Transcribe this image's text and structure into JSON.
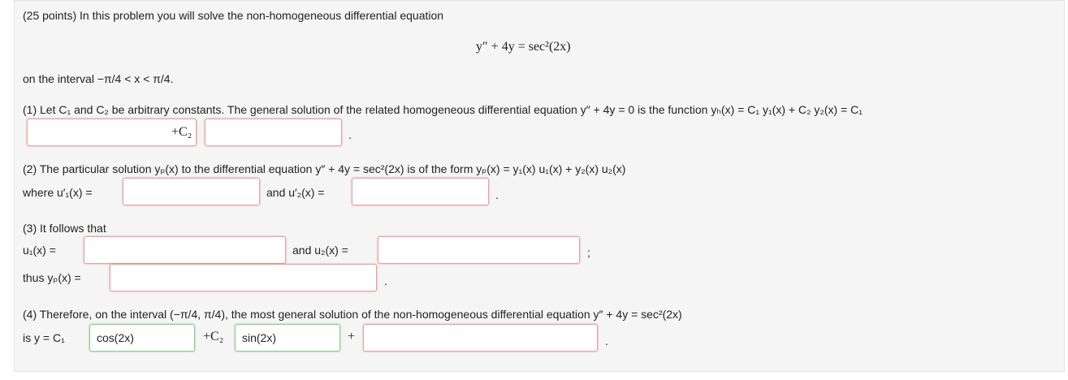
{
  "problem": {
    "header": "(25 points) In this problem you will solve the non-homogeneous differential equation",
    "main_equation": "y″ + 4y = sec²(2x)",
    "interval_text": "on the interval −π/4 < x < π/4."
  },
  "part1": {
    "text": "(1) Let C₁ and C₂ be arbitrary constants. The general solution of the related homogeneous differential equation y″ + 4y = 0 is the function yₕ(x) = C₁ y₁(x) + C₂ y₂(x) = C₁",
    "plus_c2": "+C₂",
    "trail": ".",
    "answer1": "",
    "answer2": ""
  },
  "part2": {
    "text": "(2) The particular solution yₚ(x) to the differential equation y″ + 4y = sec²(2x) is of the form yₚ(x) = y₁(x) u₁(x) + y₂(x) u₂(x)",
    "where_label": "where u′₁(x) =",
    "and_label": "and u′₂(x) =",
    "trail": ".",
    "answer1": "",
    "answer2": ""
  },
  "part3": {
    "text": "(3) It follows that",
    "u1_label": "u₁(x) =",
    "and_label": "and u₂(x) =",
    "trail1": ";",
    "thus_label": "thus yₚ(x) =",
    "trail2": ".",
    "answer_u1": "",
    "answer_u2": "",
    "answer_yp": ""
  },
  "part4": {
    "text": "(4) Therefore, on the interval (−π/4, π/4), the most general solution of the non-homogeneous differential equation y″ + 4y = sec²(2x)",
    "is_label": "is y = C₁",
    "answer_c1": "cos(2x)",
    "plus_c2": "+C₂",
    "answer_c2": "sin(2x)",
    "plus": "+",
    "answer_rest": "",
    "trail": "."
  },
  "colors": {
    "empty_border": "#e8a0a0",
    "correct_border": "#8fc88f",
    "panel_bg": "#f5f5f5"
  }
}
